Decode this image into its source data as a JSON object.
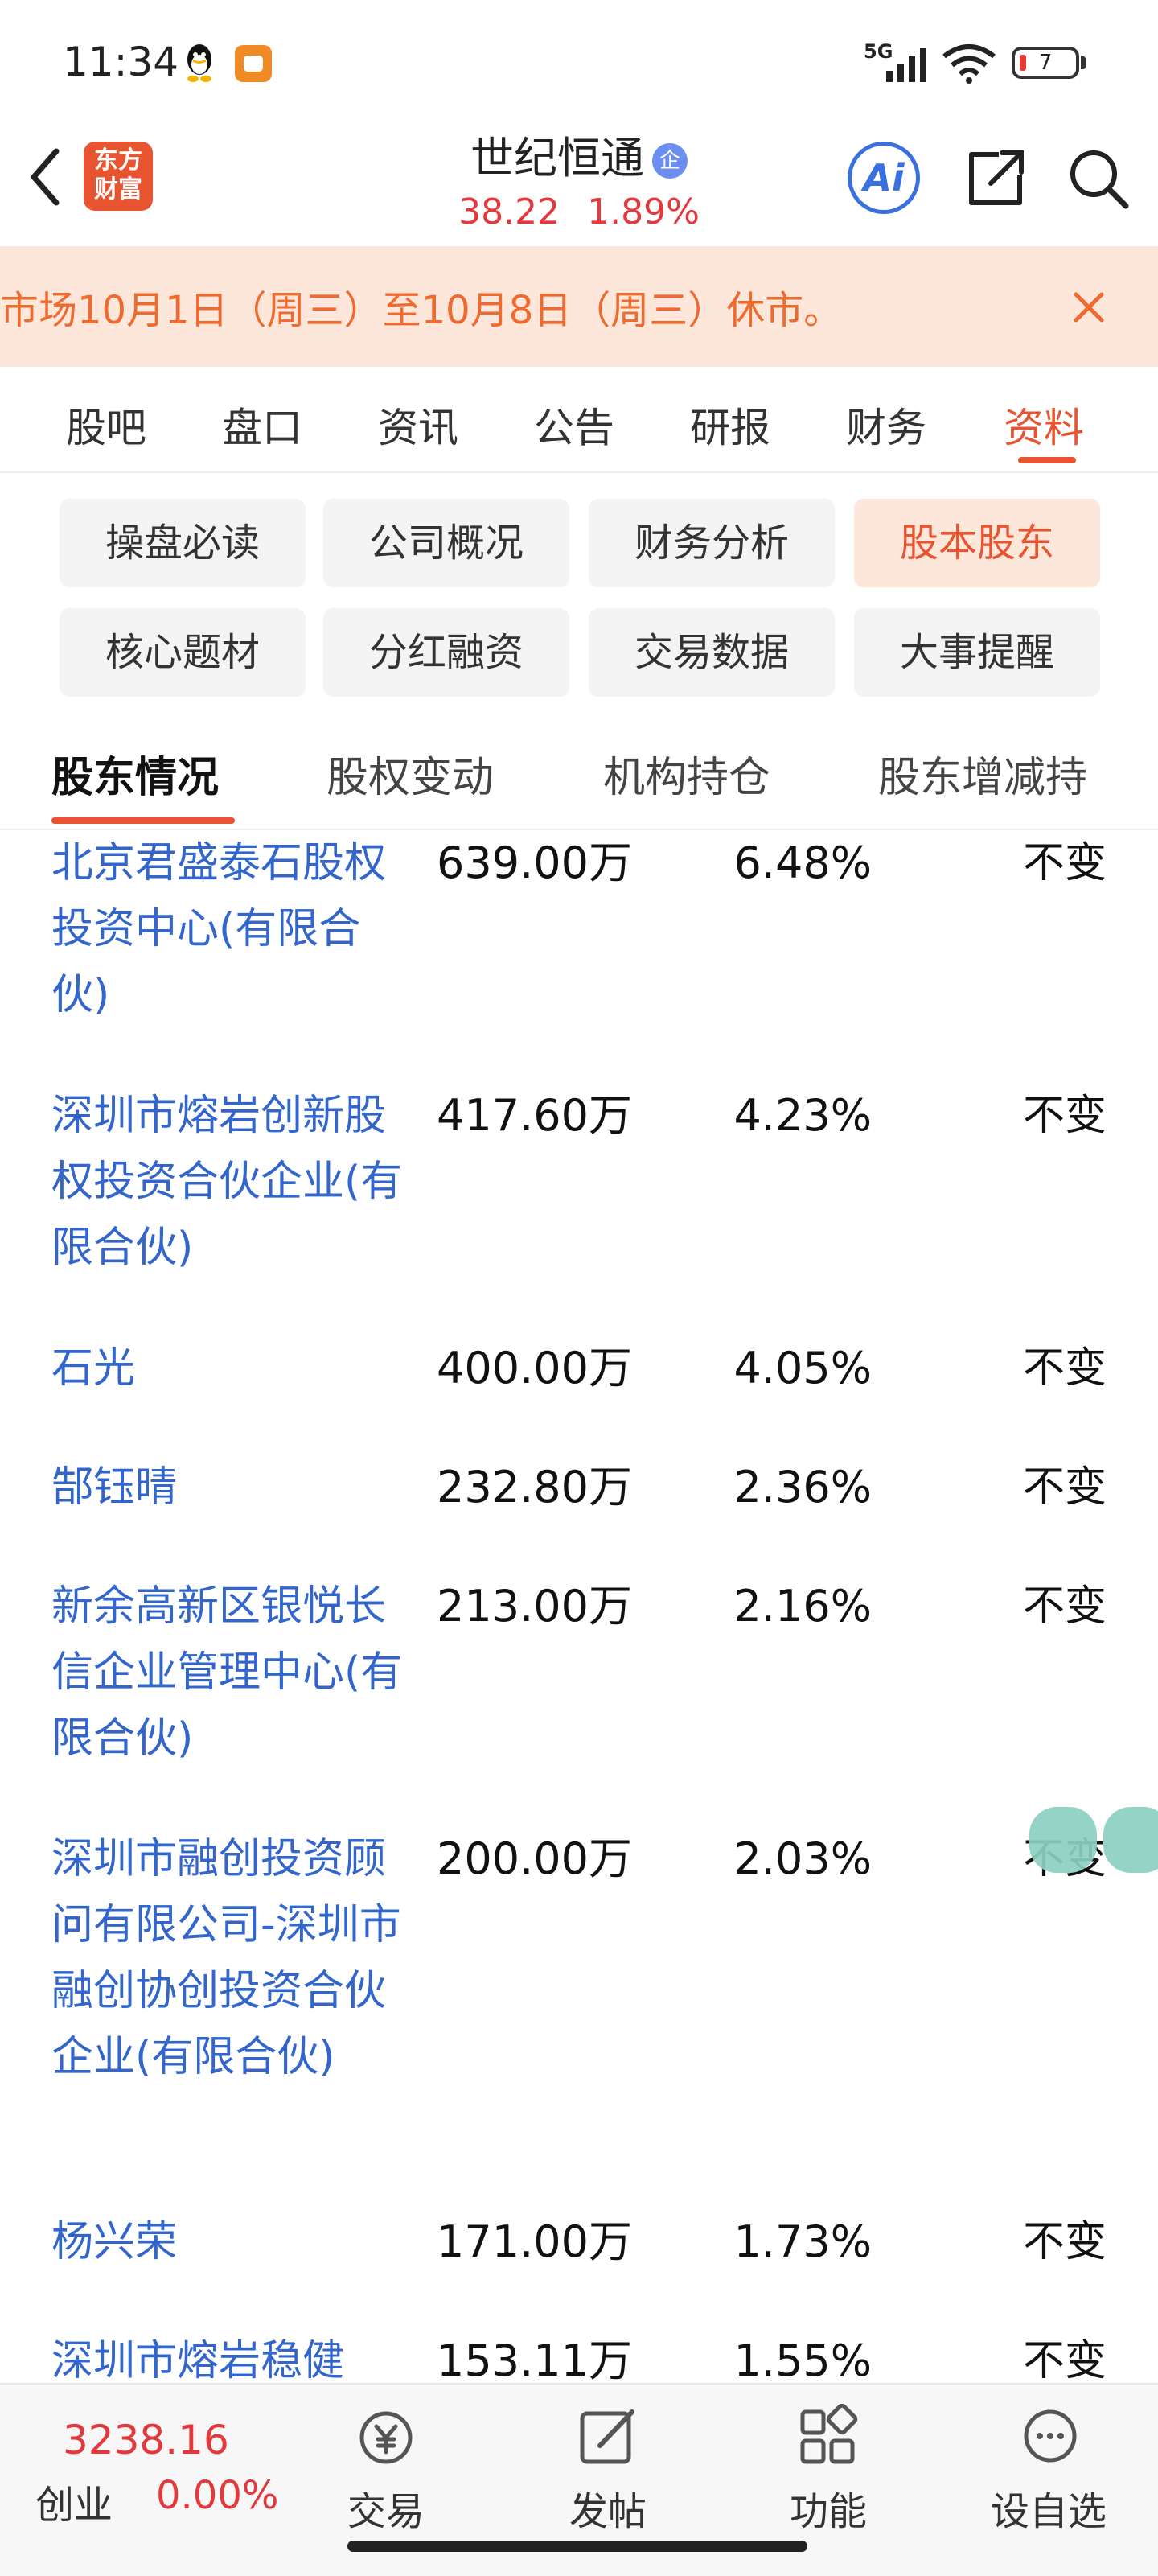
{
  "status_bar": {
    "time": "11:34",
    "network": "5G",
    "battery_level": "7"
  },
  "header": {
    "logo_line1": "东方",
    "logo_line2": "财富",
    "stock_name": "世纪恒通",
    "badge": "企",
    "price": "38.22",
    "change_pct": "1.89%",
    "ai_label": "Ai"
  },
  "notice": {
    "text": "市场10月1日（周三）至10月8日（周三）休市。"
  },
  "main_tabs": [
    "股吧",
    "盘口",
    "资讯",
    "公告",
    "研报",
    "财务",
    "资料"
  ],
  "sub_chips": [
    "操盘必读",
    "公司概况",
    "财务分析",
    "股本股东",
    "核心题材",
    "分红融资",
    "交易数据",
    "大事提醒"
  ],
  "section_tabs": [
    "股东情况",
    "股权变动",
    "机构持仓",
    "股东增减持"
  ],
  "shareholders": [
    {
      "name": "北京君盛泰石股权投资中心(有限合伙)",
      "shares": "639.00万",
      "ratio": "6.48%",
      "change": "不变"
    },
    {
      "name": "深圳市熔岩创新股权投资合伙企业(有限合伙)",
      "shares": "417.60万",
      "ratio": "4.23%",
      "change": "不变"
    },
    {
      "name": "石光",
      "shares": "400.00万",
      "ratio": "4.05%",
      "change": "不变"
    },
    {
      "name": "郜钰晴",
      "shares": "232.80万",
      "ratio": "2.36%",
      "change": "不变"
    },
    {
      "name": "新余高新区银悦长信企业管理中心(有限合伙)",
      "shares": "213.00万",
      "ratio": "2.16%",
      "change": "不变"
    },
    {
      "name": "深圳市融创投资顾问有限公司-深圳市融创协创投资合伙企业(有限合伙)",
      "shares": "200.00万",
      "ratio": "2.03%",
      "change": "不变"
    },
    {
      "name": "杨兴荣",
      "shares": "171.00万",
      "ratio": "1.73%",
      "change": "不变"
    },
    {
      "name": "深圳市熔岩稳健",
      "shares": "153.11万",
      "ratio": "1.55%",
      "change": "不变"
    }
  ],
  "bottom_bar": {
    "index_value": "3238.16",
    "index_name": "创业",
    "index_change": "0.00%",
    "trade_label": "交易",
    "post_label": "发帖",
    "function_label": "功能",
    "watchlist_label": "设自选"
  },
  "colors": {
    "accent": "#e8542f",
    "up_red": "#e4393c",
    "link_blue": "#3366cc",
    "banner_bg": "#fde6da"
  }
}
